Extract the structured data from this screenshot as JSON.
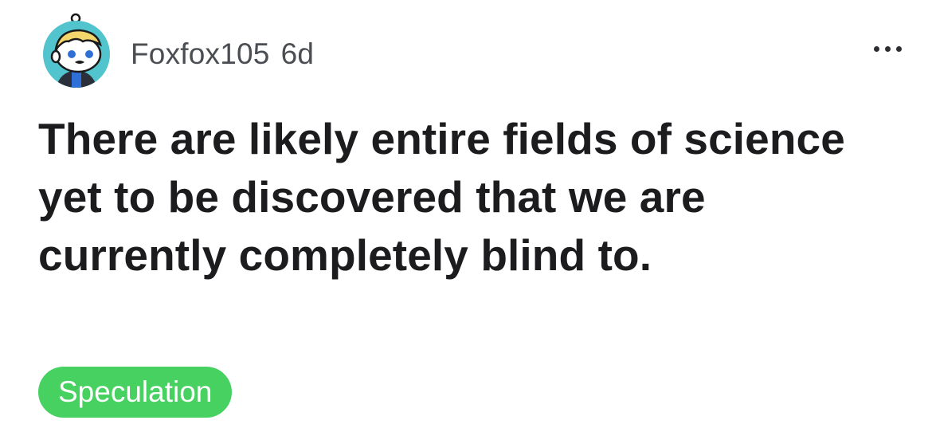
{
  "post": {
    "author": "Foxfox105",
    "age": "6d",
    "title": "There are likely entire fields of science yet to be discovered that we are currently completely blind to.",
    "flair": "Speculation"
  },
  "colors": {
    "flair_bg": "#46d160",
    "avatar_bg": "#51c4ce",
    "title_text": "#1c1c1e",
    "meta_text": "#4a4d52"
  },
  "icons": {
    "avatar": "snoo-avatar-icon",
    "more": "more-options-icon"
  }
}
